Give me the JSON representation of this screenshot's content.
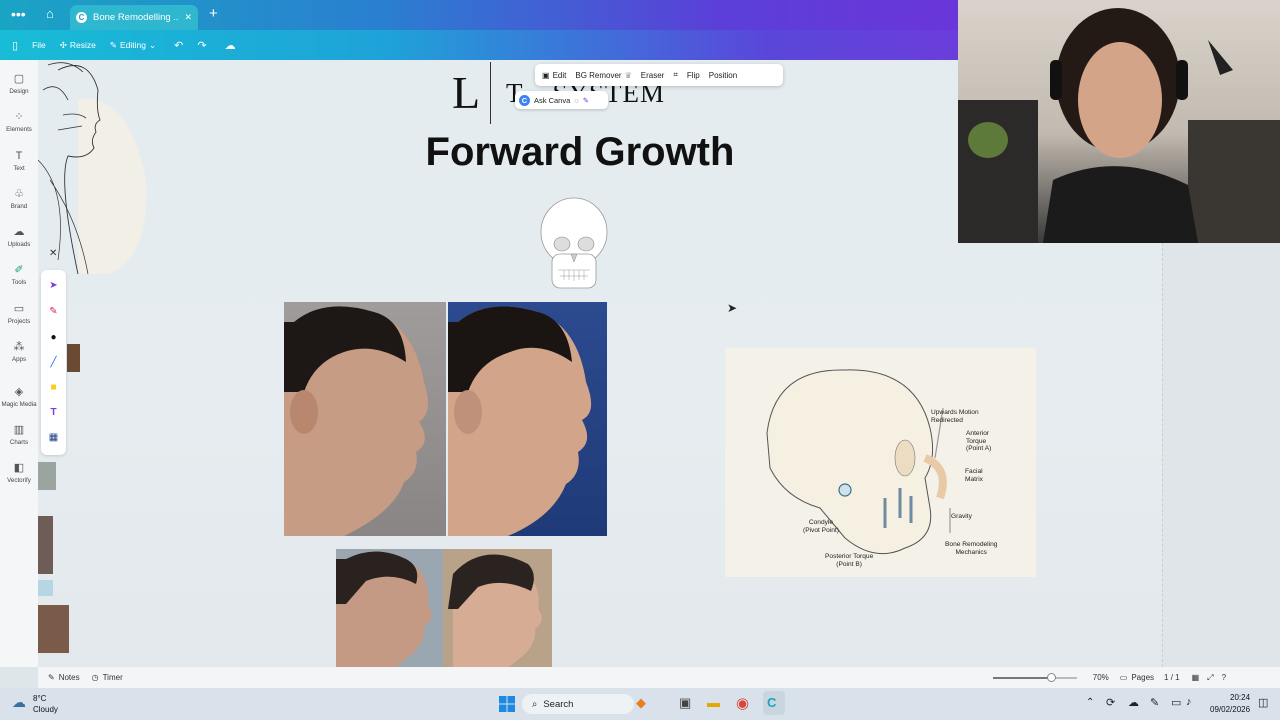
{
  "browser": {
    "tab_title": "Bone Remodelling ...",
    "colors": {
      "accent_start": "#1aa4c4",
      "accent_end": "#6a35d9"
    }
  },
  "toolbar": {
    "file": "File",
    "resize": "Resize",
    "editing": "Editing"
  },
  "sidebar": {
    "items": [
      {
        "label": "Design",
        "icon": "design-icon"
      },
      {
        "label": "Elements",
        "icon": "elements-icon"
      },
      {
        "label": "Text",
        "icon": "text-icon"
      },
      {
        "label": "Brand",
        "icon": "brand-icon"
      },
      {
        "label": "Uploads",
        "icon": "uploads-icon"
      },
      {
        "label": "Tools",
        "icon": "tools-icon"
      },
      {
        "label": "Projects",
        "icon": "projects-icon"
      },
      {
        "label": "Apps",
        "icon": "apps-icon"
      },
      {
        "label": "Magic Media",
        "icon": "magic-media-icon"
      },
      {
        "label": "Charts",
        "icon": "charts-icon"
      },
      {
        "label": "Vectorify",
        "icon": "vectorify-icon"
      }
    ]
  },
  "image_toolbar": {
    "edit": "Edit",
    "bg_remover": "BG Remover",
    "eraser": "Eraser",
    "flip": "Flip",
    "position": "Position",
    "ask_canva": "Ask Canva"
  },
  "slide": {
    "logo_letter": "L",
    "logo_text": "T... SYSTEM",
    "title": "Forward Growth",
    "diagram_labels": {
      "upwards": "Upwards Motion\nRedirected",
      "anterior": "Anterior\nTorque\n(Point A)",
      "facial": "Facial\nMatrix",
      "gravity": "Gravity",
      "condyle": "Condyle\n(Pivot Point)",
      "posterior": "Posterior Torque\n(Point B)",
      "bone": "Bone Remodeling\nMechanics"
    }
  },
  "statusbar": {
    "notes": "Notes",
    "timer": "Timer",
    "zoom": "70%",
    "zoom_fraction": 0.7,
    "pages_label": "Pages",
    "pages_value": "1 / 1"
  },
  "taskbar": {
    "weather_temp": "8°C",
    "weather_desc": "Cloudy",
    "search": "Search",
    "time": "20:24",
    "date": "09/02/2026"
  }
}
